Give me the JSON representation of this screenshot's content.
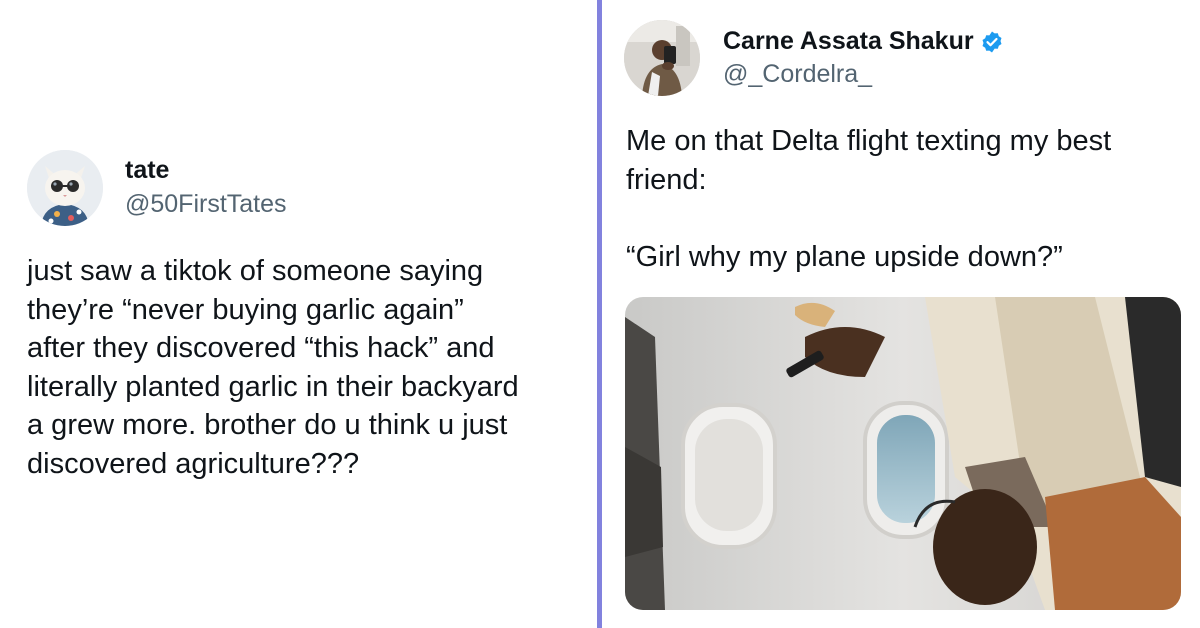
{
  "left_tweet": {
    "display_name": "tate",
    "handle": "@50FirstTates",
    "avatar_icon": "cat-with-sunglasses-avatar",
    "body": "just saw a tiktok of someone saying\nthey’re “never buying garlic again”\nafter they discovered “this hack” and\nliterally planted garlic in their backyard\na grew more. brother do u think u just\ndiscovered agriculture???"
  },
  "right_tweet": {
    "display_name": "Carne Assata Shakur",
    "handle": "@_Cordelra_",
    "verified": true,
    "verified_color": "#1d9bf0",
    "avatar_icon": "mirror-selfie-avatar",
    "body": "Me on that Delta flight texting my best\nfriend:\n\n“Girl why my plane upside down?”",
    "media_icon": "upside-down-airplane-cabin-photo"
  },
  "divider_color": "#8282de"
}
